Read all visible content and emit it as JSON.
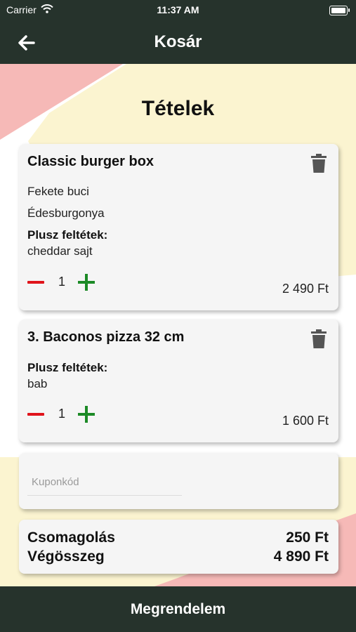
{
  "status_bar": {
    "carrier": "Carrier",
    "time": "11:37 AM"
  },
  "header": {
    "title": "Kosár",
    "back_icon": "arrow-left-icon"
  },
  "section_title": "Tételek",
  "items": [
    {
      "name": "Classic burger box",
      "options": [
        "Fekete buci",
        "Édesburgonya"
      ],
      "extras_label": "Plusz feltétek:",
      "extras": "cheddar sajt",
      "quantity": "1",
      "price": "2 490 Ft"
    },
    {
      "name": "3. Baconos pizza 32 cm",
      "options": [],
      "extras_label": "Plusz feltétek:",
      "extras": "bab",
      "quantity": "1",
      "price": "1 600 Ft"
    }
  ],
  "coupon": {
    "placeholder": "Kuponkód",
    "value": ""
  },
  "summary": {
    "packaging_label": "Csomagolás",
    "packaging_value": "250 Ft",
    "total_label": "Végösszeg",
    "total_value": "4 890 Ft"
  },
  "order_button": "Megrendelem",
  "colors": {
    "header": "#26332c",
    "minus": "#e0141b",
    "plus": "#1c8a26",
    "pink": "#f6b9b7",
    "cream": "#fbf4d0"
  }
}
